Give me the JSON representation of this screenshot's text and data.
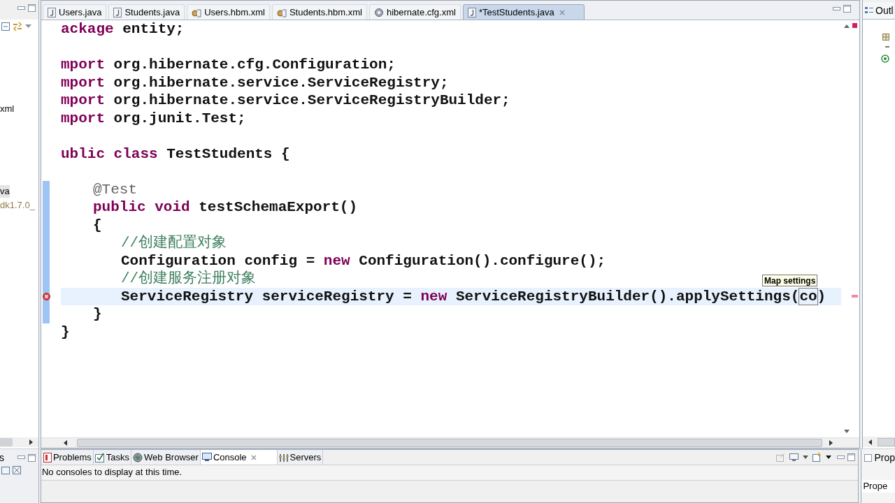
{
  "left_panel": {
    "items": [
      {
        "label": "xml",
        "kind": "file",
        "selected": false
      },
      {
        "label": "va",
        "kind": "file",
        "selected": true
      },
      {
        "label": "dk1.7.0_",
        "kind": "library",
        "selected": false
      }
    ],
    "bottom_tab": "s"
  },
  "editor": {
    "tabs": [
      {
        "label": "Users.java",
        "kind": "java",
        "selected": false
      },
      {
        "label": "Students.java",
        "kind": "java",
        "selected": false
      },
      {
        "label": "Users.hbm.xml",
        "kind": "xml",
        "selected": false
      },
      {
        "label": "Students.hbm.xml",
        "kind": "xml",
        "selected": false
      },
      {
        "label": "hibernate.cfg.xml",
        "kind": "cfg",
        "selected": false
      },
      {
        "label": "*TestStudents.java",
        "kind": "java",
        "selected": true
      }
    ],
    "lines": [
      {
        "kind": "code",
        "changed": false,
        "current": false,
        "error": false,
        "segments": [
          {
            "text": "ackage",
            "kind": "keyword"
          },
          {
            "text": " entity;",
            "kind": "plain"
          }
        ]
      },
      {
        "kind": "blank"
      },
      {
        "kind": "code",
        "changed": false,
        "current": false,
        "error": false,
        "segments": [
          {
            "text": "mport",
            "kind": "keyword"
          },
          {
            "text": " org.hibernate.cfg.Configuration;",
            "kind": "plain"
          }
        ]
      },
      {
        "kind": "code",
        "changed": false,
        "current": false,
        "error": false,
        "segments": [
          {
            "text": "mport",
            "kind": "keyword"
          },
          {
            "text": " org.hibernate.service.ServiceRegistry;",
            "kind": "plain"
          }
        ]
      },
      {
        "kind": "code",
        "changed": false,
        "current": false,
        "error": false,
        "segments": [
          {
            "text": "mport",
            "kind": "keyword"
          },
          {
            "text": " org.hibernate.service.ServiceRegistryBuilder;",
            "kind": "plain"
          }
        ]
      },
      {
        "kind": "code",
        "changed": false,
        "current": false,
        "error": false,
        "segments": [
          {
            "text": "mport",
            "kind": "keyword"
          },
          {
            "text": " org.junit.Test;",
            "kind": "plain"
          }
        ]
      },
      {
        "kind": "blank"
      },
      {
        "kind": "code",
        "changed": false,
        "current": false,
        "error": false,
        "segments": [
          {
            "text": "ublic class",
            "kind": "keyword"
          },
          {
            "text": " TestStudents {",
            "kind": "plain"
          }
        ],
        "children": [
          {
            "kind": "blank"
          },
          {
            "kind": "code",
            "changed": true,
            "current": false,
            "error": false,
            "segments": [
              {
                "text": "@Test",
                "kind": "annotation"
              }
            ]
          },
          {
            "kind": "code",
            "changed": true,
            "current": false,
            "error": false,
            "segments": [
              {
                "text": "public void",
                "kind": "keyword"
              },
              {
                "text": " testSchemaExport()",
                "kind": "plain"
              }
            ]
          },
          {
            "kind": "code",
            "changed": true,
            "current": false,
            "error": false,
            "segments": [
              {
                "text": "{",
                "kind": "plain"
              }
            ],
            "children": [
              {
                "kind": "code",
                "changed": true,
                "current": false,
                "error": false,
                "segments": [
                  {
                    "text": "//创建配置对象",
                    "kind": "comment"
                  }
                ]
              },
              {
                "kind": "code",
                "changed": true,
                "current": false,
                "error": false,
                "segments": [
                  {
                    "text": "Configuration config = ",
                    "kind": "plain"
                  },
                  {
                    "text": "new",
                    "kind": "keyword"
                  },
                  {
                    "text": " Configuration().configure();",
                    "kind": "plain"
                  }
                ]
              },
              {
                "kind": "code",
                "changed": true,
                "current": false,
                "error": false,
                "segments": [
                  {
                    "text": "//创建服务注册对象",
                    "kind": "comment"
                  }
                ]
              },
              {
                "kind": "code",
                "changed": true,
                "current": true,
                "error": true,
                "segments": [
                  {
                    "text": "ServiceRegistry serviceRegistry = ",
                    "kind": "plain"
                  },
                  {
                    "text": "new",
                    "kind": "keyword"
                  },
                  {
                    "text": " ServiceRegistryBuilder().applySettings(",
                    "kind": "plain"
                  },
                  {
                    "text": "co",
                    "kind": "linked"
                  },
                  {
                    "text": ")",
                    "kind": "plain"
                  }
                ]
              }
            ]
          },
          {
            "kind": "code",
            "changed": true,
            "current": false,
            "error": false,
            "segments": [
              {
                "text": "}",
                "kind": "plain"
              }
            ]
          }
        ]
      },
      {
        "kind": "code",
        "changed": false,
        "current": false,
        "error": false,
        "segments": [
          {
            "text": "}",
            "kind": "plain"
          }
        ]
      }
    ],
    "tooltip": "Map settings"
  },
  "bottom_panel": {
    "tabs": [
      {
        "label": "Problems",
        "kind": "problems",
        "selected": false
      },
      {
        "label": "Tasks",
        "kind": "tasks",
        "selected": false
      },
      {
        "label": "Web Browser",
        "kind": "browser",
        "selected": false
      },
      {
        "label": "Console",
        "kind": "console",
        "selected": true
      },
      {
        "label": "Servers",
        "kind": "servers",
        "selected": false
      }
    ],
    "message": "No consoles to display at this time."
  },
  "right_panel": {
    "outline_tab": "Outl",
    "properties_tab": "Prop",
    "properties_header": "Prope"
  }
}
